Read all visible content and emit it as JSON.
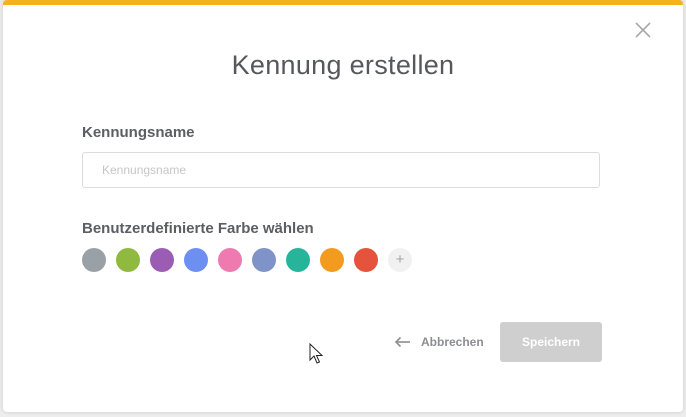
{
  "dialog": {
    "title": "Kennung erstellen",
    "accent_color": "#f5b21b",
    "close_icon": "close-icon"
  },
  "name_field": {
    "label": "Kennungsname",
    "value": "",
    "placeholder": "Kennungsname"
  },
  "color_picker": {
    "label": "Benutzerdefinierte Farbe wählen",
    "colors": [
      "#9aa1a6",
      "#8fb93f",
      "#9b5cb4",
      "#6e8ff2",
      "#ee7ab0",
      "#7f93c9",
      "#26b49b",
      "#f39b1f",
      "#e5533d"
    ],
    "add_label": "+"
  },
  "actions": {
    "cancel_label": "Abbrechen",
    "cancel_icon": "arrow-left-icon",
    "save_label": "Speichern"
  }
}
